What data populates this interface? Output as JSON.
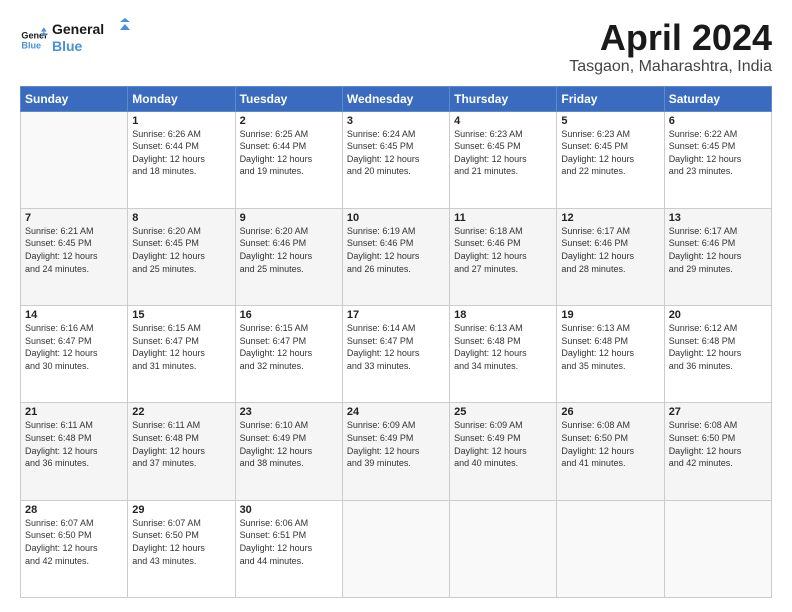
{
  "logo": {
    "line1": "General",
    "line2": "Blue"
  },
  "title": "April 2024",
  "subtitle": "Tasgaon, Maharashtra, India",
  "days_header": [
    "Sunday",
    "Monday",
    "Tuesday",
    "Wednesday",
    "Thursday",
    "Friday",
    "Saturday"
  ],
  "weeks": [
    [
      {
        "day": "",
        "info": ""
      },
      {
        "day": "1",
        "info": "Sunrise: 6:26 AM\nSunset: 6:44 PM\nDaylight: 12 hours\nand 18 minutes."
      },
      {
        "day": "2",
        "info": "Sunrise: 6:25 AM\nSunset: 6:44 PM\nDaylight: 12 hours\nand 19 minutes."
      },
      {
        "day": "3",
        "info": "Sunrise: 6:24 AM\nSunset: 6:45 PM\nDaylight: 12 hours\nand 20 minutes."
      },
      {
        "day": "4",
        "info": "Sunrise: 6:23 AM\nSunset: 6:45 PM\nDaylight: 12 hours\nand 21 minutes."
      },
      {
        "day": "5",
        "info": "Sunrise: 6:23 AM\nSunset: 6:45 PM\nDaylight: 12 hours\nand 22 minutes."
      },
      {
        "day": "6",
        "info": "Sunrise: 6:22 AM\nSunset: 6:45 PM\nDaylight: 12 hours\nand 23 minutes."
      }
    ],
    [
      {
        "day": "7",
        "info": "Sunrise: 6:21 AM\nSunset: 6:45 PM\nDaylight: 12 hours\nand 24 minutes."
      },
      {
        "day": "8",
        "info": "Sunrise: 6:20 AM\nSunset: 6:45 PM\nDaylight: 12 hours\nand 25 minutes."
      },
      {
        "day": "9",
        "info": "Sunrise: 6:20 AM\nSunset: 6:46 PM\nDaylight: 12 hours\nand 25 minutes."
      },
      {
        "day": "10",
        "info": "Sunrise: 6:19 AM\nSunset: 6:46 PM\nDaylight: 12 hours\nand 26 minutes."
      },
      {
        "day": "11",
        "info": "Sunrise: 6:18 AM\nSunset: 6:46 PM\nDaylight: 12 hours\nand 27 minutes."
      },
      {
        "day": "12",
        "info": "Sunrise: 6:17 AM\nSunset: 6:46 PM\nDaylight: 12 hours\nand 28 minutes."
      },
      {
        "day": "13",
        "info": "Sunrise: 6:17 AM\nSunset: 6:46 PM\nDaylight: 12 hours\nand 29 minutes."
      }
    ],
    [
      {
        "day": "14",
        "info": "Sunrise: 6:16 AM\nSunset: 6:47 PM\nDaylight: 12 hours\nand 30 minutes."
      },
      {
        "day": "15",
        "info": "Sunrise: 6:15 AM\nSunset: 6:47 PM\nDaylight: 12 hours\nand 31 minutes."
      },
      {
        "day": "16",
        "info": "Sunrise: 6:15 AM\nSunset: 6:47 PM\nDaylight: 12 hours\nand 32 minutes."
      },
      {
        "day": "17",
        "info": "Sunrise: 6:14 AM\nSunset: 6:47 PM\nDaylight: 12 hours\nand 33 minutes."
      },
      {
        "day": "18",
        "info": "Sunrise: 6:13 AM\nSunset: 6:48 PM\nDaylight: 12 hours\nand 34 minutes."
      },
      {
        "day": "19",
        "info": "Sunrise: 6:13 AM\nSunset: 6:48 PM\nDaylight: 12 hours\nand 35 minutes."
      },
      {
        "day": "20",
        "info": "Sunrise: 6:12 AM\nSunset: 6:48 PM\nDaylight: 12 hours\nand 36 minutes."
      }
    ],
    [
      {
        "day": "21",
        "info": "Sunrise: 6:11 AM\nSunset: 6:48 PM\nDaylight: 12 hours\nand 36 minutes."
      },
      {
        "day": "22",
        "info": "Sunrise: 6:11 AM\nSunset: 6:48 PM\nDaylight: 12 hours\nand 37 minutes."
      },
      {
        "day": "23",
        "info": "Sunrise: 6:10 AM\nSunset: 6:49 PM\nDaylight: 12 hours\nand 38 minutes."
      },
      {
        "day": "24",
        "info": "Sunrise: 6:09 AM\nSunset: 6:49 PM\nDaylight: 12 hours\nand 39 minutes."
      },
      {
        "day": "25",
        "info": "Sunrise: 6:09 AM\nSunset: 6:49 PM\nDaylight: 12 hours\nand 40 minutes."
      },
      {
        "day": "26",
        "info": "Sunrise: 6:08 AM\nSunset: 6:50 PM\nDaylight: 12 hours\nand 41 minutes."
      },
      {
        "day": "27",
        "info": "Sunrise: 6:08 AM\nSunset: 6:50 PM\nDaylight: 12 hours\nand 42 minutes."
      }
    ],
    [
      {
        "day": "28",
        "info": "Sunrise: 6:07 AM\nSunset: 6:50 PM\nDaylight: 12 hours\nand 42 minutes."
      },
      {
        "day": "29",
        "info": "Sunrise: 6:07 AM\nSunset: 6:50 PM\nDaylight: 12 hours\nand 43 minutes."
      },
      {
        "day": "30",
        "info": "Sunrise: 6:06 AM\nSunset: 6:51 PM\nDaylight: 12 hours\nand 44 minutes."
      },
      {
        "day": "",
        "info": ""
      },
      {
        "day": "",
        "info": ""
      },
      {
        "day": "",
        "info": ""
      },
      {
        "day": "",
        "info": ""
      }
    ]
  ]
}
